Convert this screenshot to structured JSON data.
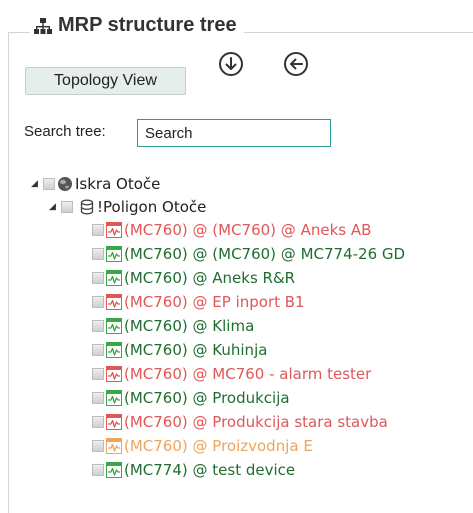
{
  "panel": {
    "title": "MRP structure tree",
    "title_icon": "hierarchy-icon"
  },
  "toolbar": {
    "topology_label": "Topology View",
    "expand_icon": "arrow-down-circle-icon",
    "back_icon": "arrow-left-circle-icon"
  },
  "search": {
    "label": "Search tree:",
    "placeholder": "Search",
    "value": ""
  },
  "tree": {
    "root": {
      "label": "Iskra Otoče",
      "icon": "globe-icon"
    },
    "group": {
      "label": "!Poligon Otoče",
      "icon": "cylinder-icon"
    },
    "devices": [
      {
        "label": "(MC760) @ (MC760) @ Aneks AB",
        "status": "red"
      },
      {
        "label": "(MC760) @ (MC760) @ MC774-26 GD",
        "status": "green"
      },
      {
        "label": "(MC760) @ Aneks R&R",
        "status": "green"
      },
      {
        "label": "(MC760) @ EP inport B1",
        "status": "red"
      },
      {
        "label": "(MC760) @ Klima",
        "status": "green"
      },
      {
        "label": "(MC760) @ Kuhinja",
        "status": "green"
      },
      {
        "label": "(MC760) @ MC760 - alarm tester",
        "status": "red"
      },
      {
        "label": "(MC760) @ Produkcija",
        "status": "green"
      },
      {
        "label": "(MC760) @ Produkcija stara stavba",
        "status": "red"
      },
      {
        "label": "(MC760) @ Proizvodnja E",
        "status": "orange"
      },
      {
        "label": "(MC774) @ test device",
        "status": "green"
      }
    ]
  },
  "colors": {
    "red": "#e05757",
    "green": "#1f6e2e",
    "orange": "#f0a35a",
    "accent": "#2a9a9a"
  }
}
